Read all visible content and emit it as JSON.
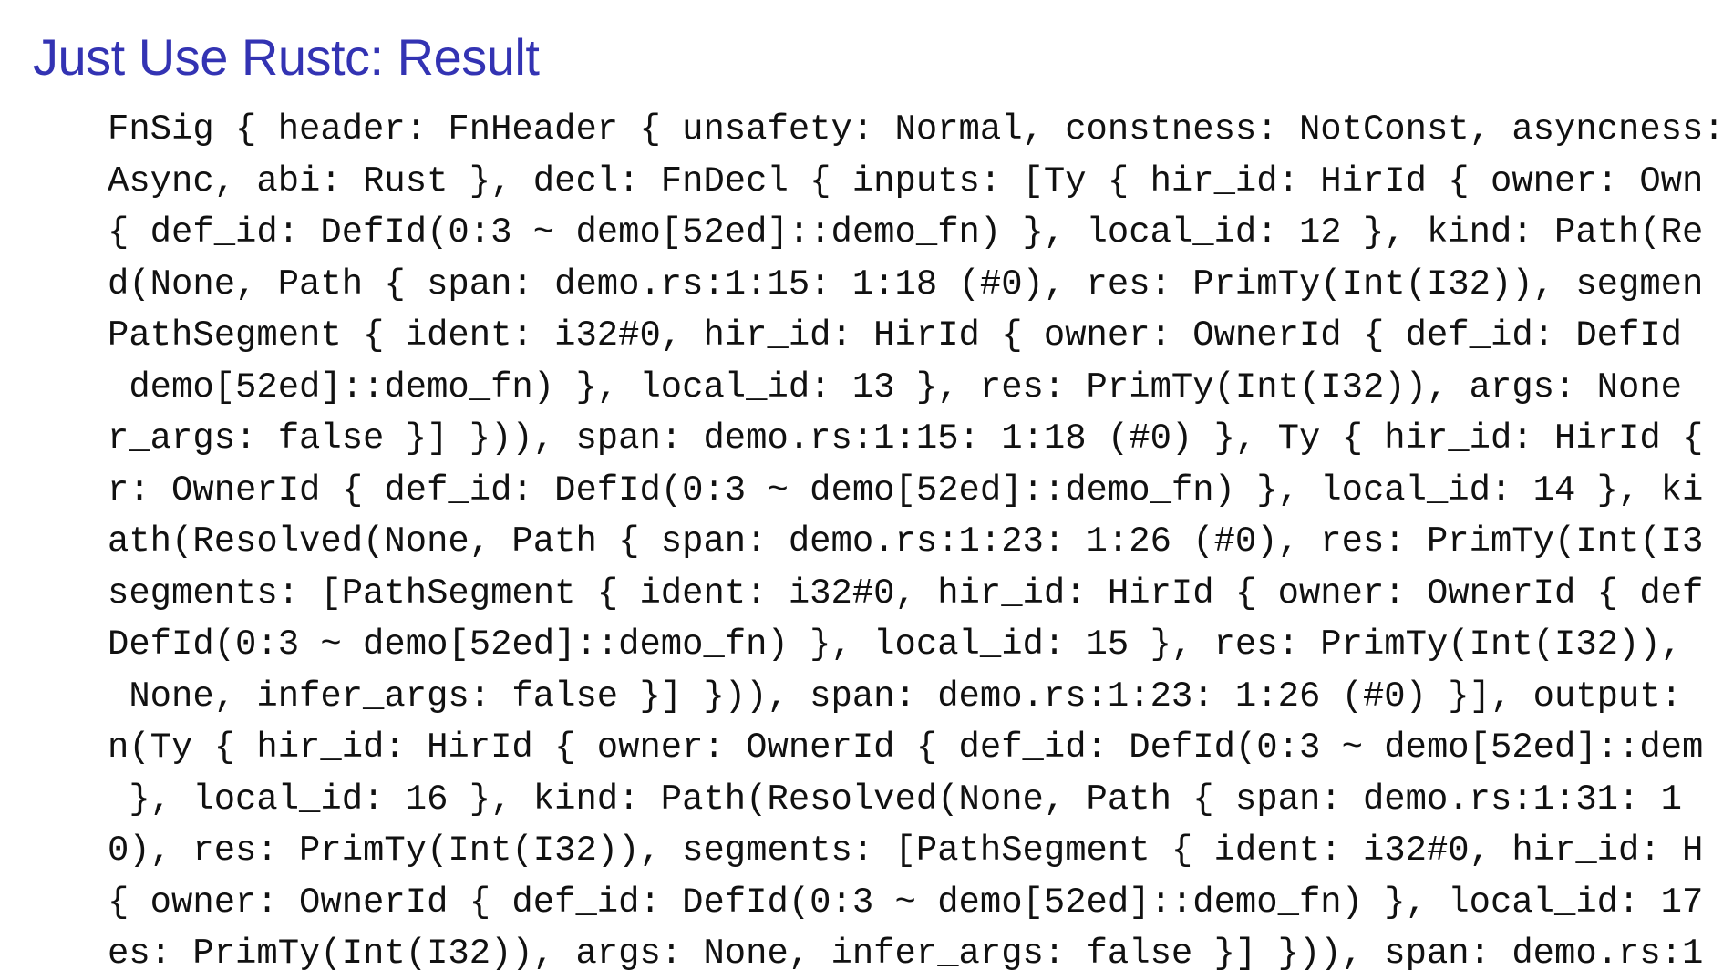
{
  "slide": {
    "title": "Just Use Rustc: Result",
    "title_color": "#3333b3",
    "code_lines": [
      "FnSig { header: FnHeader { unsafety: Normal, constness: NotConst, asyncness:",
      "Async, abi: Rust }, decl: FnDecl { inputs: [Ty { hir_id: HirId { owner: Own",
      "{ def_id: DefId(0:3 ~ demo[52ed]::demo_fn) }, local_id: 12 }, kind: Path(Re",
      "d(None, Path { span: demo.rs:1:15: 1:18 (#0), res: PrimTy(Int(I32)), segmen",
      "PathSegment { ident: i32#0, hir_id: HirId { owner: OwnerId { def_id: DefId",
      " demo[52ed]::demo_fn) }, local_id: 13 }, res: PrimTy(Int(I32)), args: None",
      "r_args: false }] })), span: demo.rs:1:15: 1:18 (#0) }, Ty { hir_id: HirId {",
      "r: OwnerId { def_id: DefId(0:3 ~ demo[52ed]::demo_fn) }, local_id: 14 }, ki",
      "ath(Resolved(None, Path { span: demo.rs:1:23: 1:26 (#0), res: PrimTy(Int(I3",
      "segments: [PathSegment { ident: i32#0, hir_id: HirId { owner: OwnerId { def",
      "DefId(0:3 ~ demo[52ed]::demo_fn) }, local_id: 15 }, res: PrimTy(Int(I32)),",
      " None, infer_args: false }] })), span: demo.rs:1:23: 1:26 (#0) }], output:",
      "n(Ty { hir_id: HirId { owner: OwnerId { def_id: DefId(0:3 ~ demo[52ed]::dem",
      " }, local_id: 16 }, kind: Path(Resolved(None, Path { span: demo.rs:1:31: 1",
      "0), res: PrimTy(Int(I32)), segments: [PathSegment { ident: i32#0, hir_id: H",
      "{ owner: OwnerId { def_id: DefId(0:3 ~ demo[52ed]::demo_fn) }, local_id: 17",
      "es: PrimTy(Int(I32)), args: None, infer_args: false }] })), span: demo.rs:1"
    ]
  }
}
